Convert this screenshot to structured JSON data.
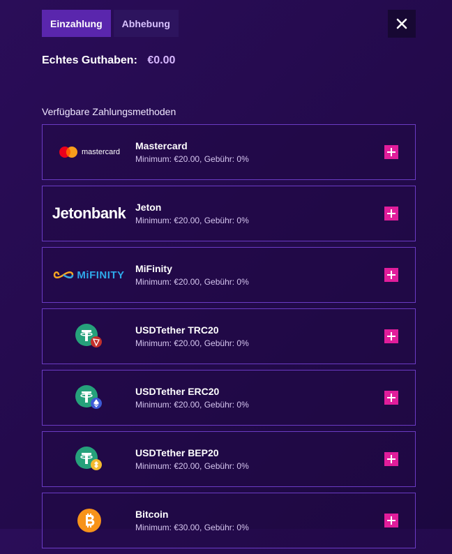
{
  "tabs": [
    {
      "label": "Einzahlung",
      "active": true
    },
    {
      "label": "Abhebung",
      "active": false
    }
  ],
  "balance": {
    "label": "Echtes Guthaben:",
    "amount": "€0.00"
  },
  "section_title": "Verfügbare Zahlungsmethoden",
  "methods": [
    {
      "name": "Mastercard",
      "meta": "Minimum: €20.00, Gebühr: 0%",
      "logo_text": "mastercard"
    },
    {
      "name": "Jeton",
      "meta": "Minimum: €20.00, Gebühr: 0%",
      "logo_text": "Jetonbank"
    },
    {
      "name": "MiFinity",
      "meta": "Minimum: €20.00, Gebühr: 0%",
      "logo_text": "MiFINITY"
    },
    {
      "name": "USDTether TRC20",
      "meta": "Minimum: €20.00, Gebühr: 0%"
    },
    {
      "name": "USDTether ERC20",
      "meta": "Minimum: €20.00, Gebühr: 0%"
    },
    {
      "name": "USDTether BEP20",
      "meta": "Minimum: €20.00, Gebühr: 0%"
    },
    {
      "name": "Bitcoin",
      "meta": "Minimum: €30.00, Gebühr: 0%"
    }
  ],
  "colors": {
    "accent": "#e11d9b",
    "tab_active": "#5a26ad",
    "border": "#6b3bc4",
    "tether": "#26a17b",
    "bitcoin": "#f7931a"
  }
}
